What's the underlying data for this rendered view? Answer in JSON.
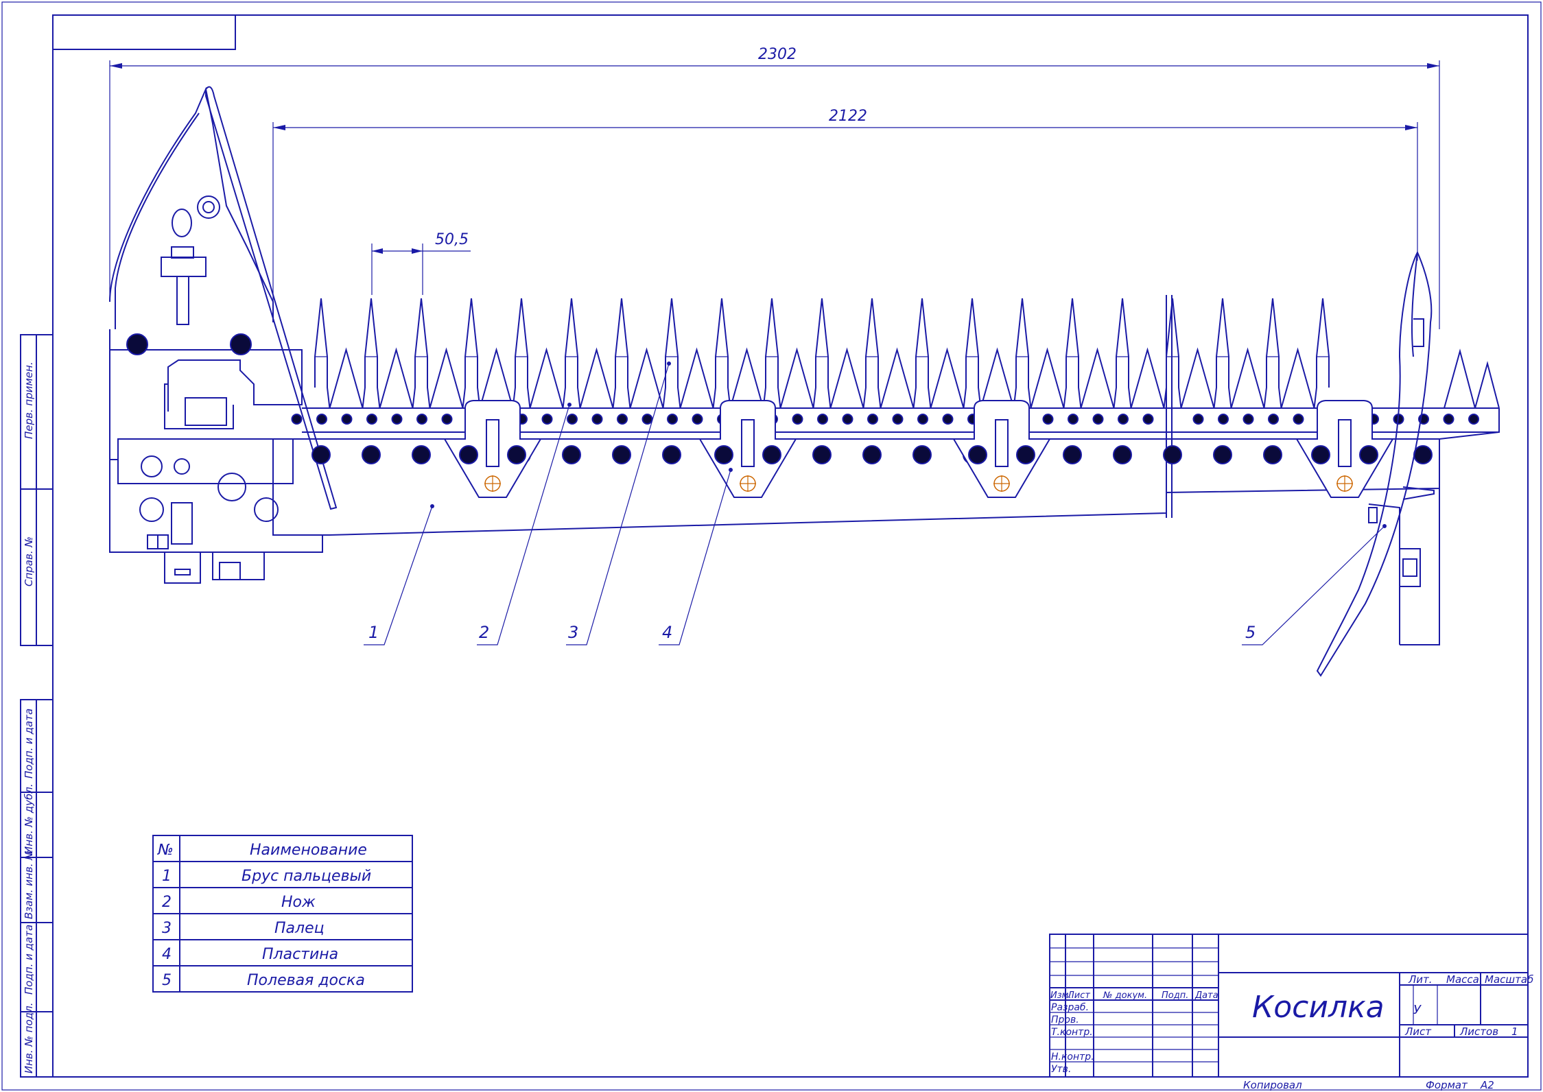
{
  "drawing": {
    "title": "Косилка",
    "dimensions": {
      "overall": "2302",
      "knife_length": "2122",
      "pitch": "50,5"
    },
    "callouts": [
      "1",
      "2",
      "3",
      "4",
      "5"
    ]
  },
  "parts_table": {
    "header": {
      "num": "№",
      "name": "Наименование"
    },
    "rows": [
      {
        "num": "1",
        "name": "Брус пальцевый"
      },
      {
        "num": "2",
        "name": "Нож"
      },
      {
        "num": "3",
        "name": "Палец"
      },
      {
        "num": "4",
        "name": "Пластина"
      },
      {
        "num": "5",
        "name": "Полевая доска"
      }
    ]
  },
  "side_stamps": [
    "Перв. примен.",
    "Справ. №",
    "Подп. и дата",
    "Инв. № дубл.",
    "Взам. инв. №",
    "Подп. и дата",
    "Инв. № подл."
  ],
  "title_block": {
    "col_headers": [
      "Изм.",
      "Лист",
      "№ докум.",
      "Подп.",
      "Дата"
    ],
    "roles": [
      "Разраб.",
      "Пров.",
      "Т.контр.",
      "Н.контр.",
      "Утв."
    ],
    "lit_label": "Лит.",
    "mass_label": "Масса",
    "scale_label": "Масштаб",
    "lit_value": "У",
    "sheet_label": "Лист",
    "sheets_label": "Листов",
    "sheets_value": "1",
    "copied_label": "Копировал",
    "format_label": "Формат",
    "format_value": "А2"
  },
  "colors": {
    "line": "#1a1aa6",
    "hole": "#0a0a3a",
    "paper": "#ffffff",
    "accent": "#cc6600"
  }
}
